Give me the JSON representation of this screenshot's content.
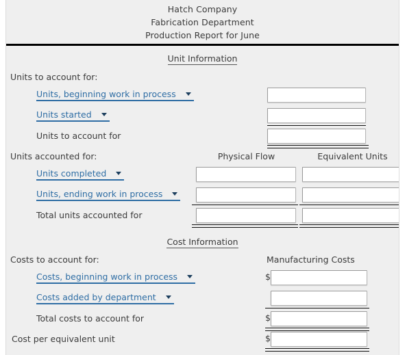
{
  "report": {
    "title_lines": [
      "Hatch Company",
      "Fabrication Department",
      "Production Report for June"
    ],
    "unit_section": {
      "heading": "Unit Information",
      "to_account_label": "Units to account for:",
      "rows": [
        {
          "select_value": "Units, beginning work in process",
          "amount": ""
        },
        {
          "select_value": "Units started",
          "amount": ""
        }
      ],
      "total_to_account_label": "Units to account for",
      "total_to_account_value": "",
      "accounted_label": "Units accounted for:",
      "col_physical": "Physical Flow",
      "col_equivalent": "Equivalent Units",
      "accounted_rows": [
        {
          "select_value": "Units completed",
          "physical": "",
          "equivalent": ""
        },
        {
          "select_value": "Units, ending work in process",
          "physical": "",
          "equivalent": ""
        }
      ],
      "total_accounted_label": "Total units accounted for",
      "total_accounted_physical": "",
      "total_accounted_equivalent": ""
    },
    "cost_section": {
      "heading": "Cost Information",
      "to_account_label": "Costs to account for:",
      "col_manufacturing": "Manufacturing Costs",
      "currency_symbol": "$",
      "rows": [
        {
          "select_value": "Costs, beginning work in process",
          "amount": ""
        },
        {
          "select_value": "Costs added by department",
          "amount": ""
        }
      ],
      "total_label": "Total costs to account for",
      "total_value": "",
      "per_unit_label": "Cost per equivalent unit",
      "per_unit_value": ""
    },
    "colors": {
      "select_text": "#2e6da4",
      "body_text": "#3a3a3a",
      "page_bg": "#efefef",
      "rule": "#111111"
    }
  }
}
